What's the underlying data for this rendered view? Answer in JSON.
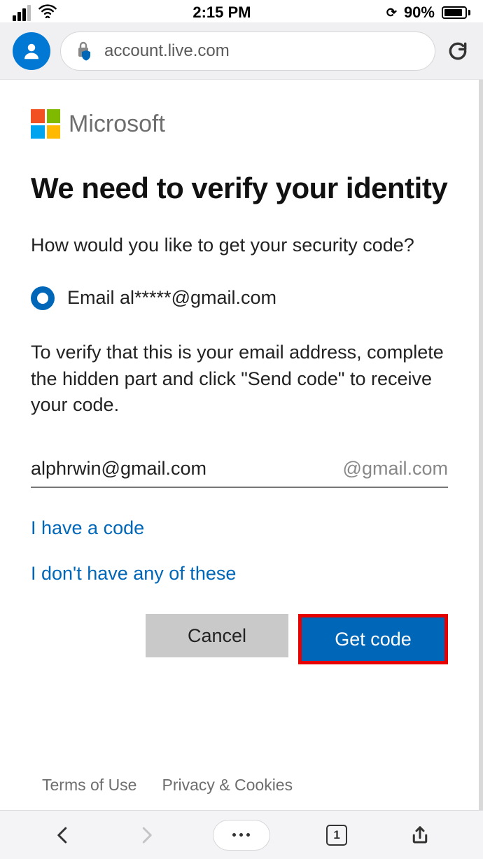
{
  "status": {
    "time": "2:15 PM",
    "battery_pct": "90%"
  },
  "browser": {
    "url": "account.live.com",
    "tab_count": "1"
  },
  "brand": {
    "name": "Microsoft"
  },
  "page": {
    "headline": "We need to verify your identity",
    "subhead": "How would you like to get your security code?",
    "radio_option": "Email al*****@gmail.com",
    "instruction": "To verify that this is your email address, complete the hidden part and click \"Send code\" to receive your code.",
    "email_value": "alphrwin@gmail.com",
    "email_suffix": "@gmail.com",
    "link_have_code": "I have a code",
    "link_none": "I don't have any of these",
    "btn_cancel": "Cancel",
    "btn_primary": "Get code"
  },
  "footer": {
    "terms": "Terms of Use",
    "privacy": "Privacy & Cookies"
  }
}
